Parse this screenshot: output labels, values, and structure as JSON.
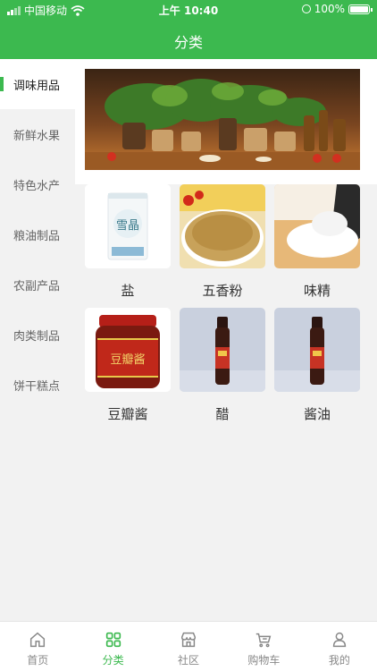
{
  "status_bar": {
    "carrier": "中国移动",
    "time": "上午 10:40",
    "battery": "100%"
  },
  "header": {
    "title": "分类"
  },
  "sidebar": {
    "items": [
      {
        "label": "调味用品",
        "active": true
      },
      {
        "label": "新鲜水果"
      },
      {
        "label": "特色水产"
      },
      {
        "label": "粮油制品"
      },
      {
        "label": "农副产品"
      },
      {
        "label": "肉类制品"
      },
      {
        "label": "饼干糕点"
      }
    ]
  },
  "products": [
    {
      "name": "盐",
      "image_text": "雪晶"
    },
    {
      "name": "五香粉"
    },
    {
      "name": "味精"
    },
    {
      "name": "豆瓣酱",
      "image_text": "豆瓣酱"
    },
    {
      "name": "醋"
    },
    {
      "name": "酱油"
    }
  ],
  "tabbar": {
    "items": [
      {
        "label": "首页",
        "icon": "home-icon"
      },
      {
        "label": "分类",
        "icon": "category-icon",
        "active": true
      },
      {
        "label": "社区",
        "icon": "store-icon"
      },
      {
        "label": "购物车",
        "icon": "cart-icon"
      },
      {
        "label": "我的",
        "icon": "user-icon"
      }
    ]
  },
  "colors": {
    "brand": "#3cb94f",
    "background": "#f2f2f2",
    "inactive": "#888888"
  }
}
